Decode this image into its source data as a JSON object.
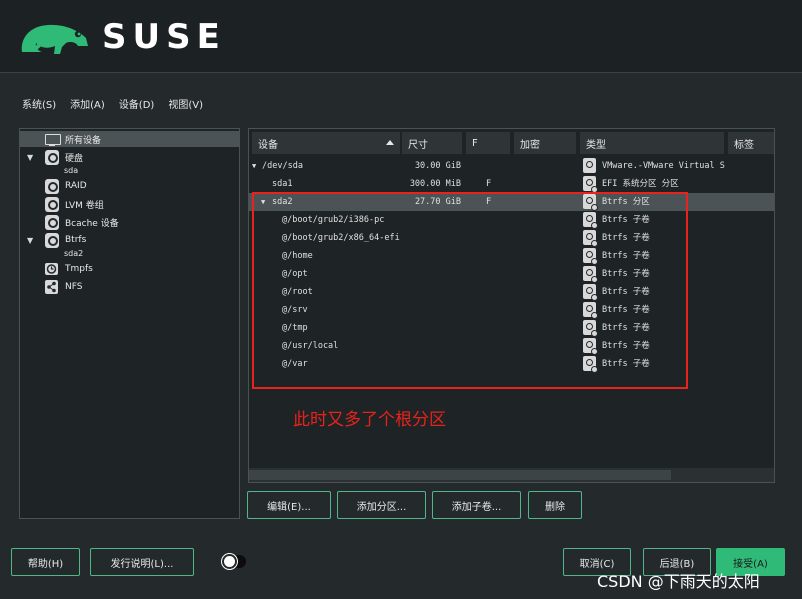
{
  "brand": {
    "name": "SUSE",
    "logo_icon": "chameleon-logo"
  },
  "menu": [
    "系统(S)",
    "添加(A)",
    "设备(D)",
    "视图(V)"
  ],
  "tree": {
    "items": [
      {
        "label": "所有设备",
        "icon": "monitor-icon",
        "selected": true
      },
      {
        "label": "硬盘",
        "icon": "disk-icon",
        "expanded": true,
        "children": [
          "sda"
        ]
      },
      {
        "label": "RAID",
        "icon": "disk-icon"
      },
      {
        "label": "LVM 卷组",
        "icon": "disk-icon"
      },
      {
        "label": "Bcache 设备",
        "icon": "disk-icon"
      },
      {
        "label": "Btrfs",
        "icon": "btrfs-icon",
        "expanded": true,
        "children": [
          "sda2"
        ]
      },
      {
        "label": "Tmpfs",
        "icon": "clock-icon"
      },
      {
        "label": "NFS",
        "icon": "share-icon"
      }
    ]
  },
  "table": {
    "headers": [
      "设备",
      "尺寸",
      "F",
      "加密",
      "类型",
      "标签"
    ],
    "rows": [
      {
        "device": "/dev/sda",
        "size": "30.00 GiB",
        "f": "",
        "type": "VMware.-VMware Virtual S",
        "indent": 0,
        "arrow": "▼"
      },
      {
        "device": "sda1",
        "size": "300.00 MiB",
        "f": "F",
        "type": "EFI 系统分区 分区",
        "indent": 1,
        "arrow": ""
      },
      {
        "device": "sda2",
        "size": "27.70 GiB",
        "f": "F",
        "type": "Btrfs 分区",
        "indent": 1,
        "arrow": "▼",
        "selected": true
      },
      {
        "device": "@/boot/grub2/i386-pc",
        "size": "",
        "f": "",
        "type": "Btrfs 子卷",
        "indent": 2,
        "arrow": ""
      },
      {
        "device": "@/boot/grub2/x86_64-efi",
        "size": "",
        "f": "",
        "type": "Btrfs 子卷",
        "indent": 2,
        "arrow": ""
      },
      {
        "device": "@/home",
        "size": "",
        "f": "",
        "type": "Btrfs 子卷",
        "indent": 2,
        "arrow": ""
      },
      {
        "device": "@/opt",
        "size": "",
        "f": "",
        "type": "Btrfs 子卷",
        "indent": 2,
        "arrow": ""
      },
      {
        "device": "@/root",
        "size": "",
        "f": "",
        "type": "Btrfs 子卷",
        "indent": 2,
        "arrow": ""
      },
      {
        "device": "@/srv",
        "size": "",
        "f": "",
        "type": "Btrfs 子卷",
        "indent": 2,
        "arrow": ""
      },
      {
        "device": "@/tmp",
        "size": "",
        "f": "",
        "type": "Btrfs 子卷",
        "indent": 2,
        "arrow": ""
      },
      {
        "device": "@/usr/local",
        "size": "",
        "f": "",
        "type": "Btrfs 子卷",
        "indent": 2,
        "arrow": ""
      },
      {
        "device": "@/var",
        "size": "",
        "f": "",
        "type": "Btrfs 子卷",
        "indent": 2,
        "arrow": ""
      }
    ]
  },
  "annotation": {
    "text": "此时又多了个根分区",
    "color": "#e8221c"
  },
  "actions": {
    "edit": "编辑(E)...",
    "add_partition": "添加分区...",
    "add_subvolume": "添加子卷...",
    "delete": "删除"
  },
  "footer": {
    "help": "帮助(H)",
    "release_notes": "发行说明(L)...",
    "cancel": "取消(C)",
    "back": "后退(B)",
    "accept": "接受(A)"
  },
  "watermark": "CSDN @下雨天的太阳",
  "colors": {
    "accent": "#30ba78",
    "annotation": "#e8221c",
    "background": "#242a2c"
  }
}
